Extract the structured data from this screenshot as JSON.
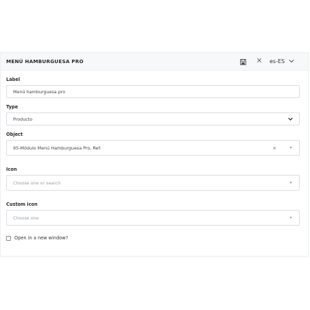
{
  "header": {
    "title": "MENÚ HAMBURGUESA PRO",
    "language": "es-ES"
  },
  "fields": {
    "label": {
      "label": "Label",
      "value": "Menú hamburguesa pro"
    },
    "type": {
      "label": "Type",
      "value": "Producto"
    },
    "object": {
      "label": "Object",
      "value": "95-Módulo Menú Hamburguesa Pro, Ref:"
    },
    "icon": {
      "label": "Icon",
      "placeholder": "Choose one or search"
    },
    "custom_icon": {
      "label": "Custom icon",
      "placeholder": "Choose one"
    }
  },
  "options": {
    "new_window_label": "Open in a new window?"
  },
  "icons": {
    "save": "save-icon",
    "close": "close-icon",
    "language_dropdown": "chevron-down-icon",
    "select_caret": "caret-down-icon",
    "clear": "clear-icon"
  }
}
